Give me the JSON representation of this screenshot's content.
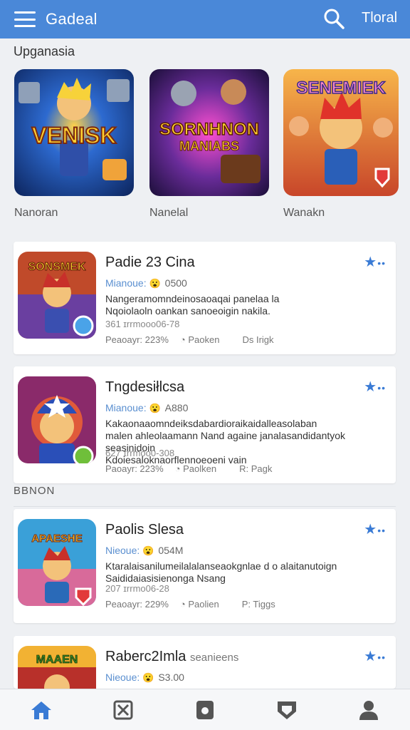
{
  "topbar": {
    "title": "Gadeal",
    "right_link": "Tloral",
    "menu_icon": "hamburger-icon",
    "search_icon": "search-icon"
  },
  "section_title": "Upganasia",
  "featured": [
    {
      "caption": "Nanoran",
      "art_text": "VENISK",
      "bg": "#1d4fa8"
    },
    {
      "caption": "Nanelal",
      "art_text": "SORNHNON",
      "art_text2": "MANIABS",
      "bg": "#6a2c9a"
    },
    {
      "caption": "Wanakn",
      "art_text": "SENEMIEK",
      "bg": "#d86b2c"
    }
  ],
  "mid_label": "BBNON",
  "cards": [
    {
      "title": "Padie 23 Cina",
      "meta_label": "Mianoue:",
      "meta_emoji": "😮",
      "meta_num": "0500",
      "desc1": "Nangeramomndeinosaoaqai panelaa  la",
      "desc2": "Nqoiolaoln oankan sanoeoigin nakila.",
      "sub": "361 ɪrrmooo06-78",
      "stats": [
        "Peaoayr: 223%",
        "Paoken",
        "Ds Irigk"
      ],
      "thumb_text": "SONSMEK",
      "accent": "#d8a24a"
    },
    {
      "title": "Tngdesiłlcsa",
      "meta_label": "Mianoue:",
      "meta_emoji": "😮",
      "meta_num": "A880",
      "desc1": "Kakaonaaomndeiksdabardioraikaidalleasolaban",
      "desc2": "malen ahleolaamann Nand againe janalasandidantyok seasinidoin",
      "desc3": "Kdoiesaloknaorflennoeoeni vain",
      "sub": "627 ɪrrmoo0-308",
      "stats": [
        "Paoayr: 223%",
        "Paolken",
        "R: Pagk"
      ],
      "thumb_text": "",
      "accent": "#3a7bd5"
    },
    {
      "title": "Paolis Slesa",
      "meta_label": "Nieoue:",
      "meta_emoji": "😮",
      "meta_num": "054M",
      "desc1": "Ktaralaisanilumeilalalanseaokgnlae d o alaitanutoign",
      "desc2": "Saididaiasisienonga Nsang",
      "sub": "207 ɪrrmo06-28",
      "stats": [
        "Peaoayr: 229%",
        "Paolien",
        "P: Tiggs"
      ],
      "thumb_text": "APAESHE",
      "accent": "#4bb3e8"
    },
    {
      "title": "Raberc2Imla",
      "title_suffix": "seanieens",
      "meta_label": "Nieoue:",
      "meta_emoji": "😮",
      "meta_num": "S3.00",
      "thumb_text": "MAAEN",
      "accent": "#f2b233"
    }
  ],
  "bottom_nav": [
    {
      "icon": "home-icon",
      "active": true
    },
    {
      "icon": "games-icon",
      "active": false
    },
    {
      "icon": "apps-icon",
      "active": false
    },
    {
      "icon": "shield-icon",
      "active": false
    },
    {
      "icon": "profile-icon",
      "active": false
    }
  ],
  "colors": {
    "topbar": "#4a88d8",
    "accent": "#3a7bd5",
    "background": "#eef0f3"
  }
}
